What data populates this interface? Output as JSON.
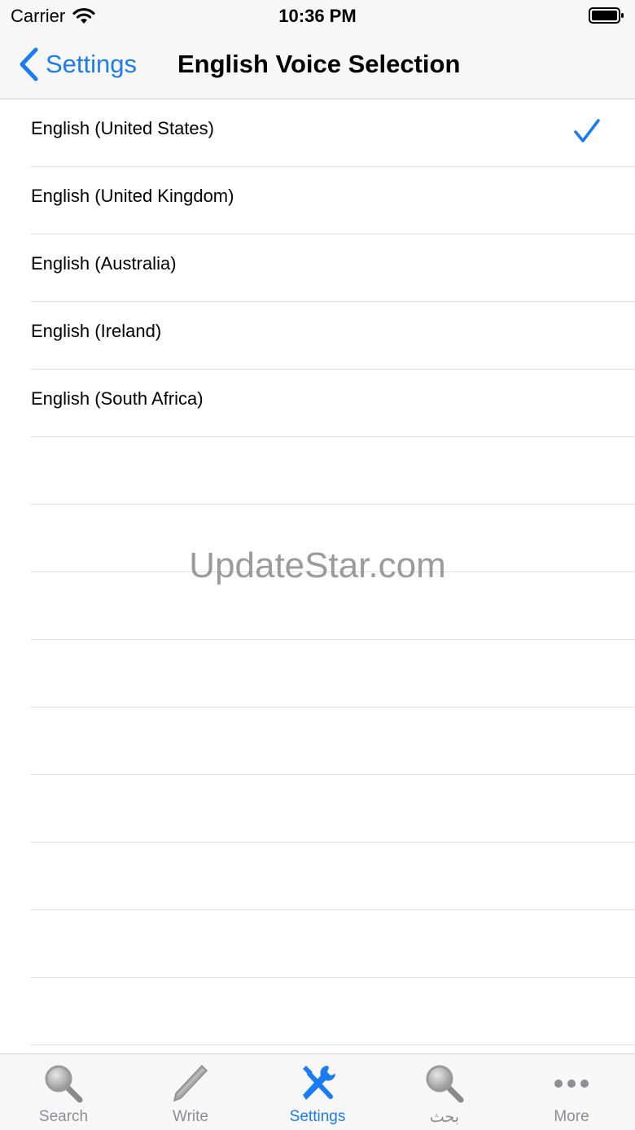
{
  "status_bar": {
    "carrier": "Carrier",
    "time": "10:36 PM"
  },
  "nav": {
    "back_label": "Settings",
    "title": "English Voice Selection"
  },
  "options": [
    {
      "label": "English (United States)",
      "selected": true
    },
    {
      "label": "English (United Kingdom)",
      "selected": false
    },
    {
      "label": "English (Australia)",
      "selected": false
    },
    {
      "label": "English (Ireland)",
      "selected": false
    },
    {
      "label": "English (South Africa)",
      "selected": false
    }
  ],
  "watermark": "UpdateStar.com",
  "tabs": [
    {
      "label": "Search",
      "icon": "magnifier-icon",
      "active": false
    },
    {
      "label": "Write",
      "icon": "pencil-icon",
      "active": false
    },
    {
      "label": "Settings",
      "icon": "tools-icon",
      "active": true
    },
    {
      "label": "بحث",
      "icon": "magnifier-icon",
      "active": false
    },
    {
      "label": "More",
      "icon": "more-dots-icon",
      "active": false
    }
  ],
  "colors": {
    "accent": "#1a7cf5",
    "inactive": "#8e8e93",
    "bar_background": "#f7f7f7"
  }
}
